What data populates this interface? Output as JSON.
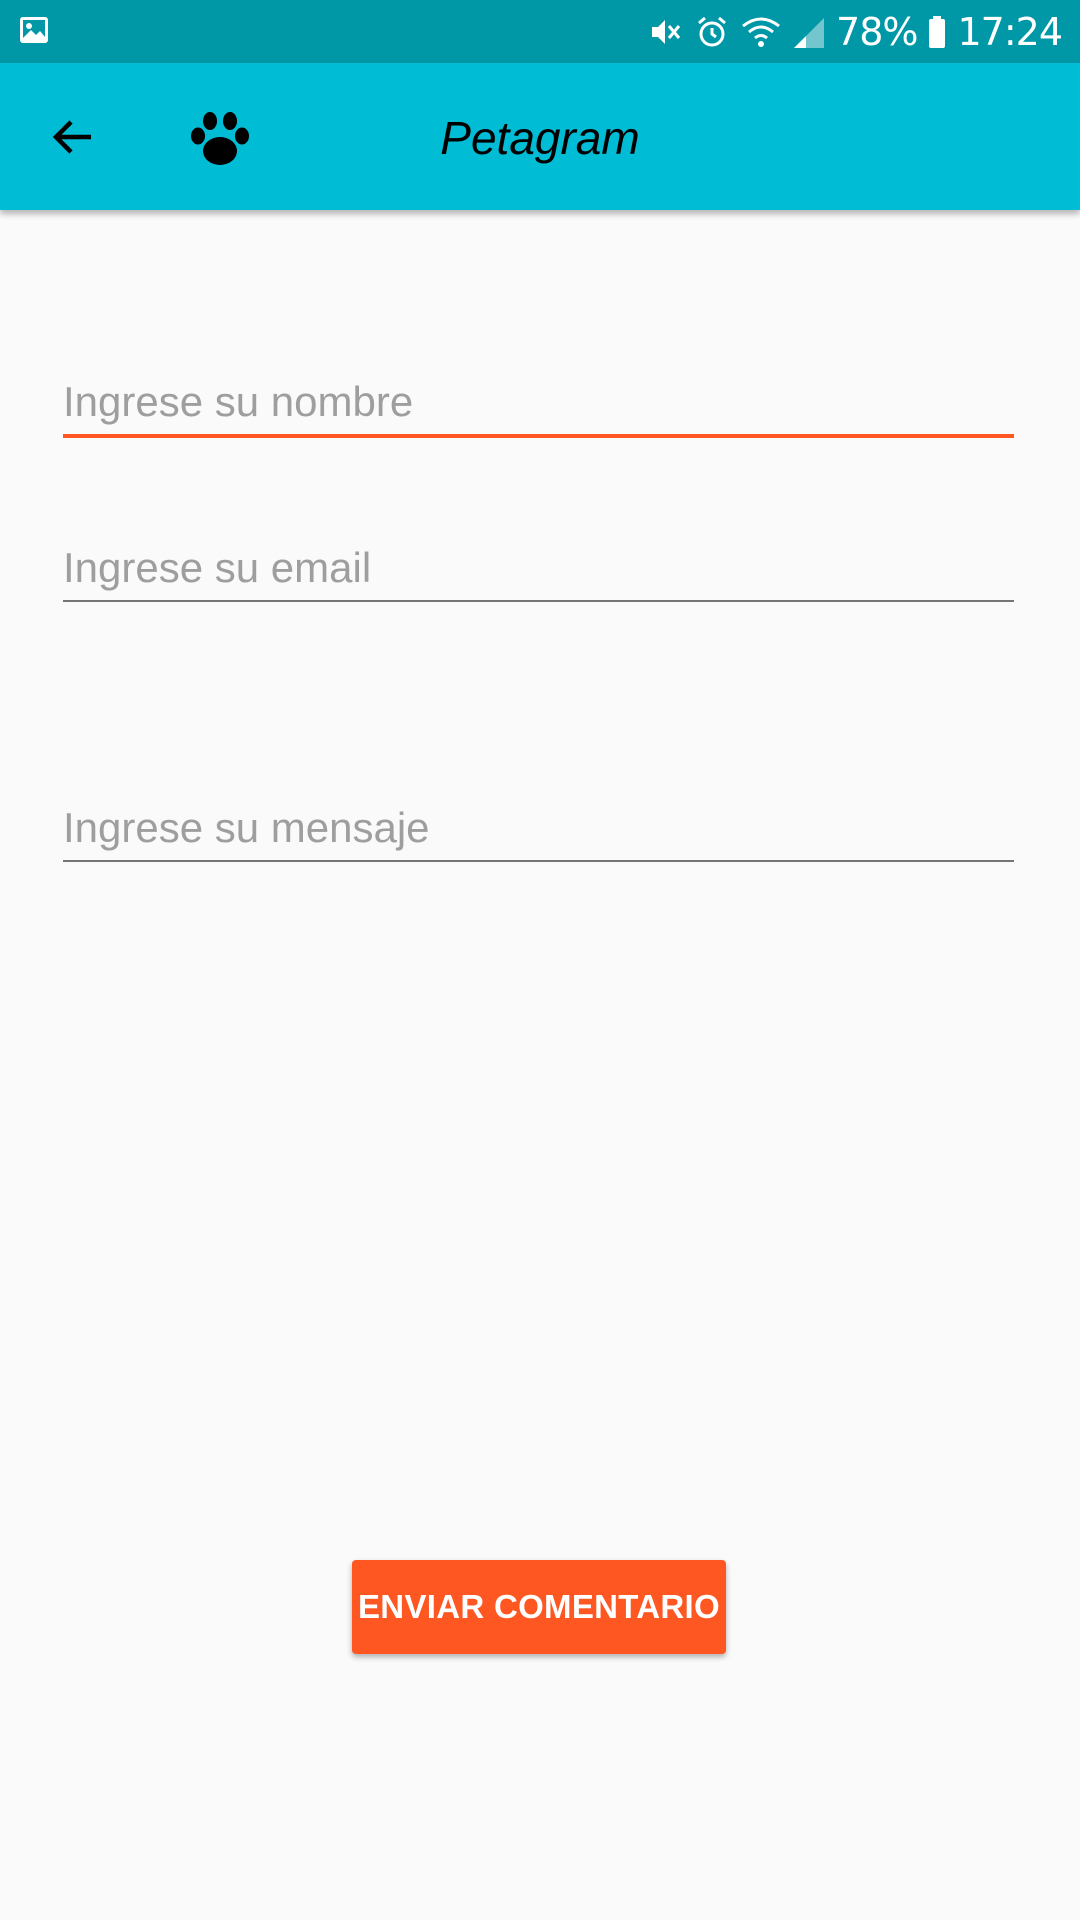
{
  "status_bar": {
    "battery_text": "78%",
    "time": "17:24",
    "icons": [
      "gallery-icon",
      "mute-icon",
      "alarm-icon",
      "wifi-icon",
      "signal-icon",
      "battery-icon"
    ]
  },
  "app_bar": {
    "title": "Petagram",
    "icons": [
      "back-arrow-icon",
      "paw-icon"
    ],
    "color": "#00bcd4"
  },
  "form": {
    "name_placeholder": "Ingrese su nombre",
    "name_value": "",
    "email_placeholder": "Ingrese su email",
    "email_value": "",
    "message_placeholder": "Ingrese su mensaje",
    "message_value": "",
    "focused_field": "name"
  },
  "submit": {
    "label": "ENVIAR COMENTARIO",
    "color": "#ff5722"
  },
  "colors": {
    "status_bar": "#0097a7",
    "accent": "#ff5722",
    "background": "#fafafa"
  }
}
